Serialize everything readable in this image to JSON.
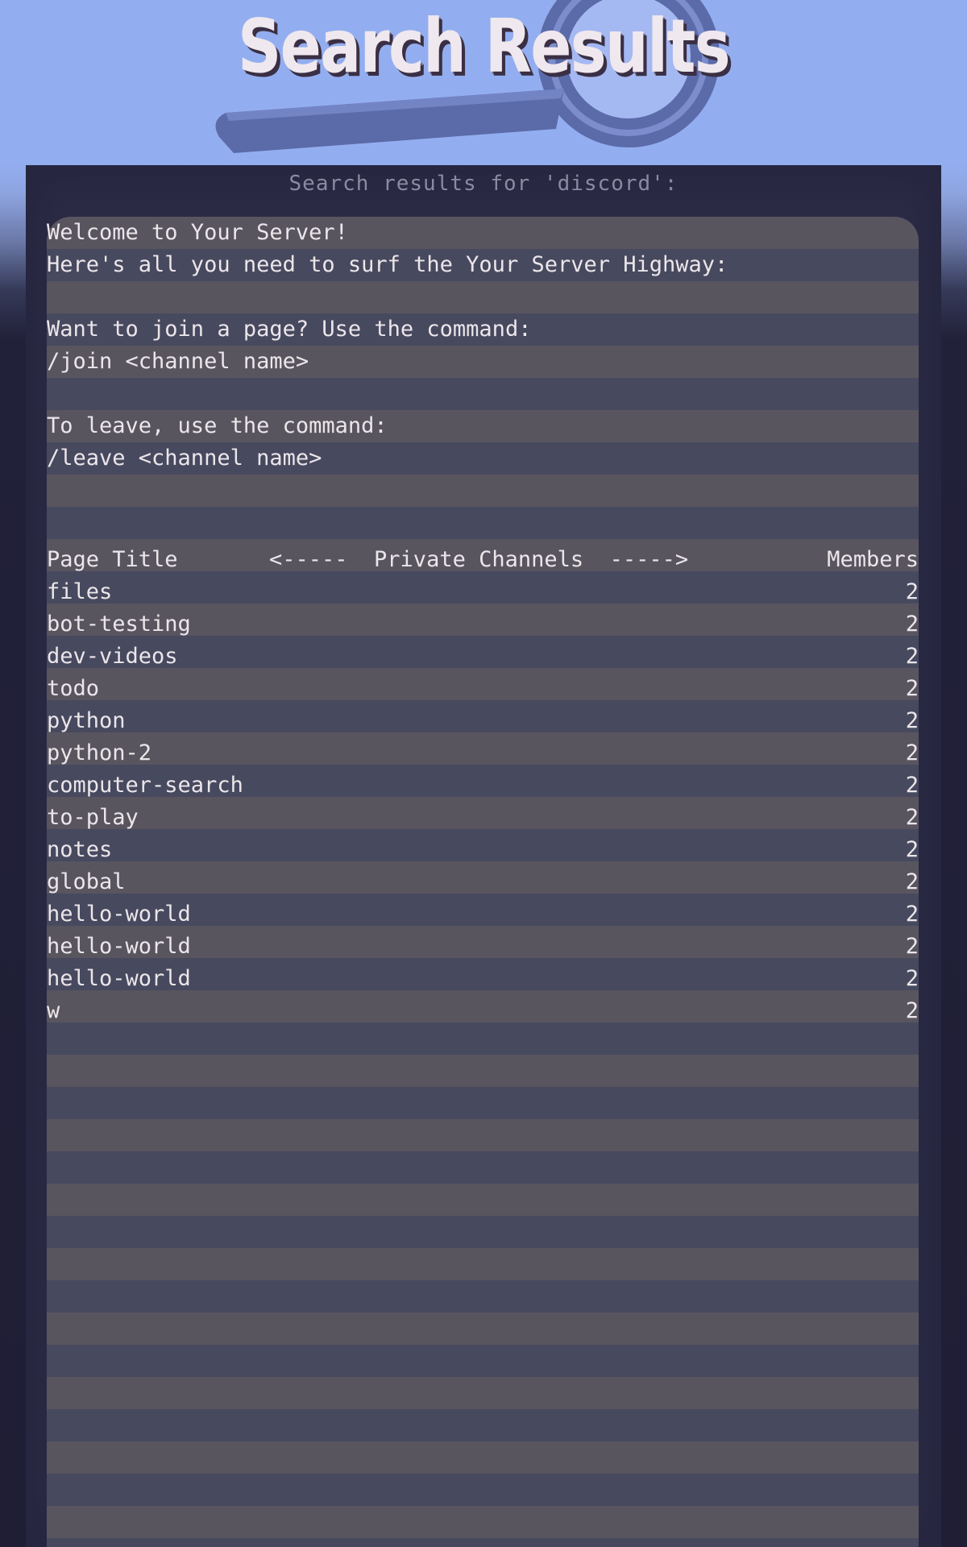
{
  "header": {
    "title": "Search Results"
  },
  "search": {
    "heading": "Search results for 'discord':"
  },
  "intro_lines": [
    "Welcome to Your Server!",
    "Here's all you need to surf the Your Server Highway:",
    "",
    "Want to join a page? Use the command:",
    "/join <channel name>",
    "",
    "To leave, use the command:",
    "/leave <channel name>"
  ],
  "table": {
    "col_title": "Page Title",
    "col_private": "<-----  Private Channels  ----->",
    "col_members": "Members",
    "rows": [
      {
        "name": "files",
        "members": "2"
      },
      {
        "name": "bot-testing",
        "members": "2"
      },
      {
        "name": "dev-videos",
        "members": "2"
      },
      {
        "name": "todo",
        "members": "2"
      },
      {
        "name": "python",
        "members": "2"
      },
      {
        "name": "python-2",
        "members": "2"
      },
      {
        "name": "computer-search",
        "members": "2"
      },
      {
        "name": "to-play",
        "members": "2"
      },
      {
        "name": "notes",
        "members": "2"
      },
      {
        "name": "global",
        "members": "2"
      },
      {
        "name": "hello-world",
        "members": "2"
      },
      {
        "name": "hello-world",
        "members": "2"
      },
      {
        "name": "hello-world",
        "members": "2"
      },
      {
        "name": "w",
        "members": "2"
      }
    ]
  },
  "icons": {
    "header_graphic": "magnifying-glass-icon"
  }
}
